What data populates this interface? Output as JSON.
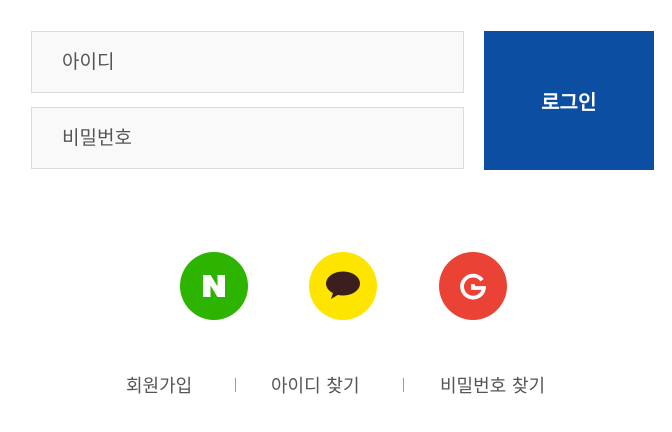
{
  "login_form": {
    "id_placeholder": "아이디",
    "password_placeholder": "비밀번호",
    "login_button_label": "로그인"
  },
  "social_login": {
    "naver": {
      "icon": "naver-icon",
      "color": "#2db400",
      "glyph": "N"
    },
    "kakao": {
      "icon": "kakao-icon",
      "color": "#fee500"
    },
    "google": {
      "icon": "google-icon",
      "color": "#ea4335",
      "glyph": "G"
    }
  },
  "links": {
    "signup": "회원가입",
    "find_id": "아이디 찾기",
    "find_password": "비밀번호 찾기"
  },
  "colors": {
    "primary": "#0b4ea2",
    "field_background": "#f9f9f9",
    "field_border": "#dcdcdc"
  }
}
